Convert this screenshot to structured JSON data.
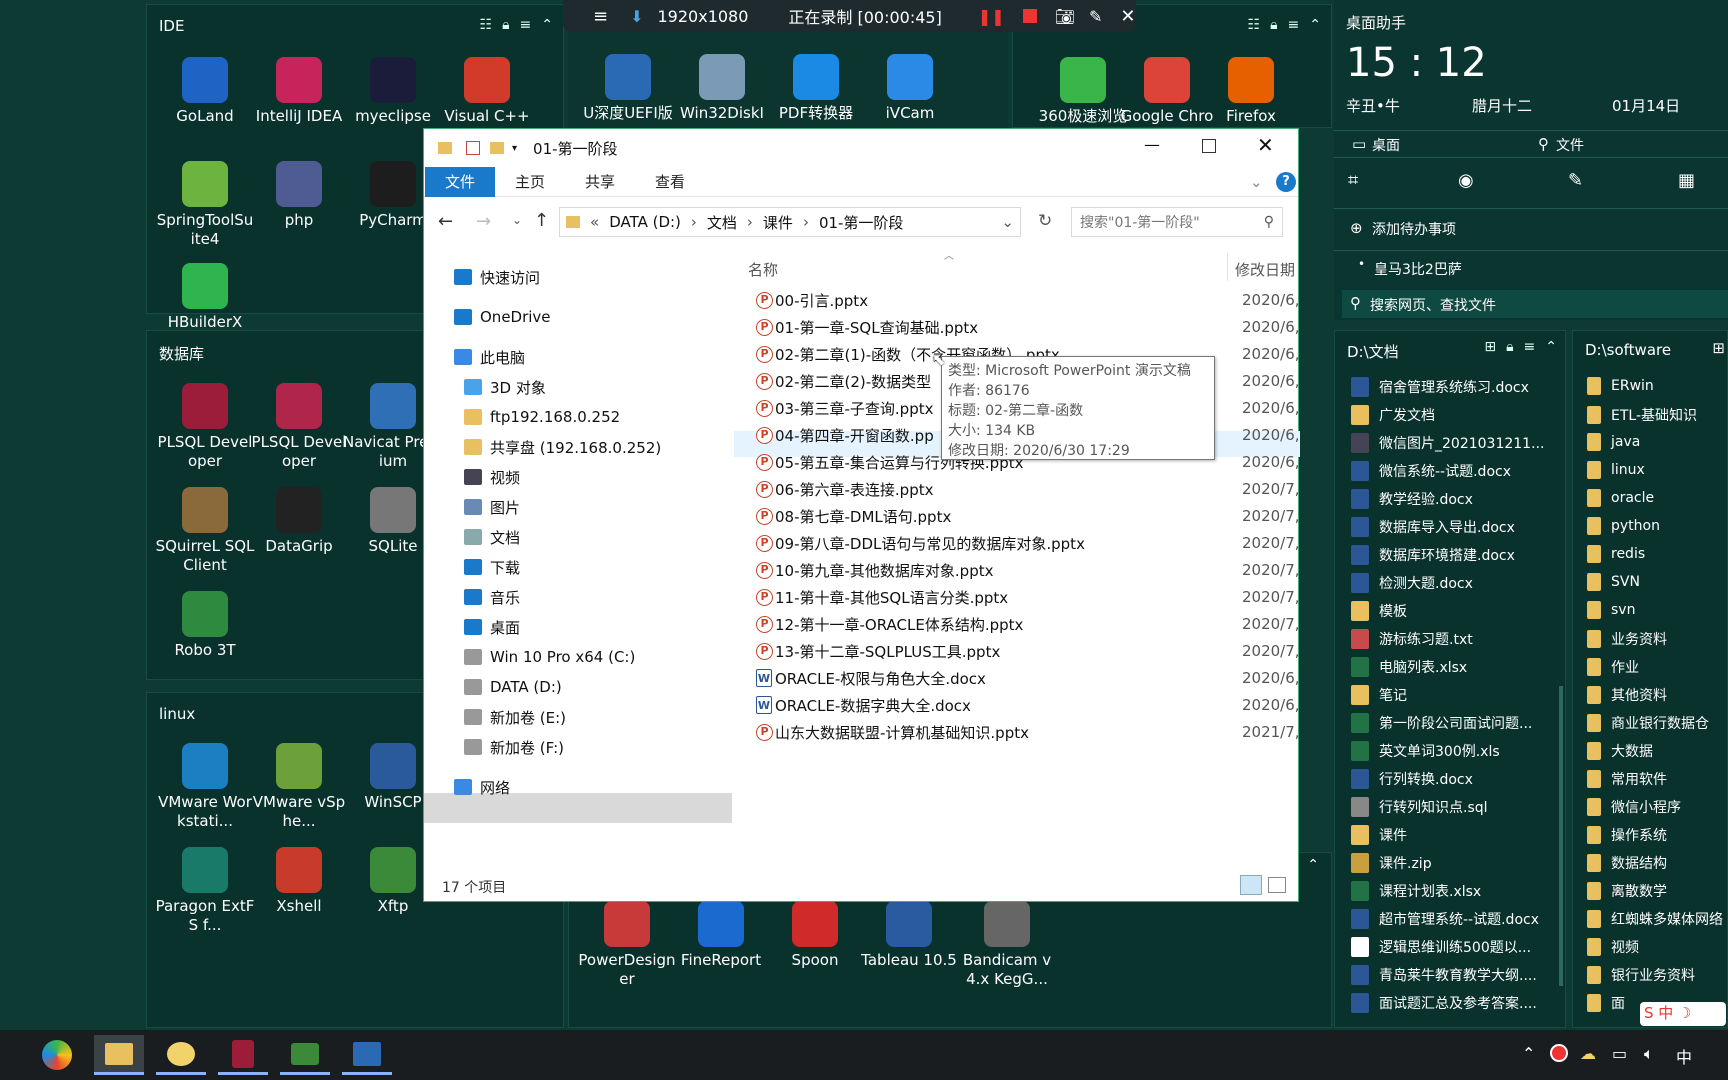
{
  "recorder": {
    "resolution": "1920x1080",
    "status": "正在录制 [00:00:45]"
  },
  "fences": {
    "ide": {
      "title": "IDE",
      "icons": [
        {
          "label": "GoLand",
          "icon": "goland-icon",
          "color": "#1f63c4"
        },
        {
          "label": "IntelliJ IDEA",
          "icon": "intellij-icon",
          "color": "#c8245c"
        },
        {
          "label": "myeclipse",
          "icon": "myeclipse-icon",
          "color": "#1b1b3a"
        },
        {
          "label": "Visual C++",
          "icon": "visual-cpp-icon",
          "color": "#d23a2a"
        },
        {
          "label": "SpringToolSuite4",
          "icon": "spring-icon",
          "color": "#6db33f"
        },
        {
          "label": "php",
          "icon": "php-icon",
          "color": "#4f5b93"
        },
        {
          "label": "PyCharm",
          "icon": "pycharm-icon",
          "color": "#1d1d1d"
        },
        {
          "label": "HBuilderX",
          "icon": "hbuilder-icon",
          "color": "#2fb550"
        }
      ]
    },
    "db": {
      "title": "数据库",
      "icons": [
        {
          "label": "PLSQL Developer",
          "icon": "plsql-icon",
          "color": "#9c1d3a"
        },
        {
          "label": "PLSQL Developer",
          "icon": "plsql-icon-2",
          "color": "#b0264a"
        },
        {
          "label": "Navicat Premium",
          "icon": "navicat-icon",
          "color": "#2e6fb6"
        },
        {
          "label": "SQuirreL SQL Client",
          "icon": "squirrel-icon",
          "color": "#8a6a3a"
        },
        {
          "label": "DataGrip",
          "icon": "datagrip-icon",
          "color": "#222"
        },
        {
          "label": "SQLite",
          "icon": "sqlite-icon",
          "color": "#777"
        },
        {
          "label": "Robo 3T",
          "icon": "robo3t-icon",
          "color": "#2d8a3e"
        }
      ]
    },
    "linux": {
      "title": "linux",
      "icons": [
        {
          "label": "VMware Workstati...",
          "icon": "vmware-icon",
          "color": "#1c7fc1"
        },
        {
          "label": "VMware vSphe...",
          "icon": "vsphere-icon",
          "color": "#6ca03a"
        },
        {
          "label": "WinSCP",
          "icon": "winscp-icon",
          "color": "#2a5a9a"
        },
        {
          "label": "Paragon ExtFS f...",
          "icon": "paragon-icon",
          "color": "#1a7a6a"
        },
        {
          "label": "Xshell",
          "icon": "xshell-icon",
          "color": "#c83a2a"
        },
        {
          "label": "Xftp",
          "icon": "xftp-icon",
          "color": "#3a8a3a"
        }
      ]
    },
    "tools": {
      "icons": [
        {
          "label": "U深度UEFI版",
          "icon": "usb-icon",
          "color": "#2a6ab5"
        },
        {
          "label": "Win32DiskI",
          "icon": "disk-icon",
          "color": "#7a9ab5"
        },
        {
          "label": "PDF转换器",
          "icon": "pdf-icon",
          "color": "#1a8ae5"
        },
        {
          "label": "iVCam",
          "icon": "ivcam-icon",
          "color": "#2a8ae5"
        }
      ]
    },
    "browsers": {
      "icons": [
        {
          "label": "360极速浏览器",
          "icon": "browser-360-icon",
          "color": "#3ab54a"
        },
        {
          "label": "Google Chrome",
          "icon": "chrome-icon",
          "color": "#db4437"
        },
        {
          "label": "Firefox",
          "icon": "firefox-icon",
          "color": "#e66000"
        }
      ]
    },
    "bottom": {
      "icons": [
        {
          "label": "PowerDesigner",
          "icon": "powerdesigner-icon",
          "color": "#c83a3a"
        },
        {
          "label": "FineReport",
          "icon": "finereport-icon",
          "color": "#1a6ad0"
        },
        {
          "label": "Spoon",
          "icon": "spoon-icon",
          "color": "#d02a2a"
        },
        {
          "label": "Tableau 10.5",
          "icon": "tableau-icon",
          "color": "#2a5aa0"
        },
        {
          "label": "Bandicam v4.x KegG...",
          "icon": "bandicam-icon",
          "color": "#666"
        }
      ]
    }
  },
  "explorer": {
    "title": "01-第一阶段",
    "tabs": [
      "文件",
      "主页",
      "共享",
      "查看"
    ],
    "breadcrumb": [
      "DATA (D:)",
      "文档",
      "课件",
      "01-第一阶段"
    ],
    "search_placeholder": "搜索\"01-第一阶段\"",
    "columns": {
      "name": "名称",
      "date": "修改日期"
    },
    "nav": [
      {
        "label": "快速访问",
        "icon": "star-icon"
      },
      {
        "label": "OneDrive",
        "icon": "cloud-icon"
      },
      {
        "label": "此电脑",
        "icon": "computer-icon"
      },
      {
        "label": "3D 对象",
        "icon": "cube-icon"
      },
      {
        "label": "ftp192.168.0.252",
        "icon": "ftp-folder-icon"
      },
      {
        "label": "共享盘 (192.168.0.252)",
        "icon": "share-folder-icon"
      },
      {
        "label": "视频",
        "icon": "video-icon"
      },
      {
        "label": "图片",
        "icon": "picture-icon"
      },
      {
        "label": "文档",
        "icon": "document-icon"
      },
      {
        "label": "下载",
        "icon": "download-icon"
      },
      {
        "label": "音乐",
        "icon": "music-icon"
      },
      {
        "label": "桌面",
        "icon": "desktop-icon"
      },
      {
        "label": "Win 10 Pro x64 (C:)",
        "icon": "drive-c-icon"
      },
      {
        "label": "DATA (D:)",
        "icon": "drive-d-icon"
      },
      {
        "label": "新加卷 (E:)",
        "icon": "drive-e-icon"
      },
      {
        "label": "新加卷 (F:)",
        "icon": "drive-f-icon"
      },
      {
        "label": "网络",
        "icon": "network-icon"
      }
    ],
    "files": [
      {
        "name": "00-引言.pptx",
        "date": "2020/6,",
        "type": "ppt"
      },
      {
        "name": "01-第一章-SQL查询基础.pptx",
        "date": "2020/6,",
        "type": "ppt"
      },
      {
        "name": "02-第二章(1)-函数（不含开窗函数）.pptx",
        "date": "2020/6,",
        "type": "ppt"
      },
      {
        "name": "02-第二章(2)-数据类型",
        "date": "2020/6,",
        "type": "ppt"
      },
      {
        "name": "03-第三章-子查询.pptx",
        "date": "2020/6,",
        "type": "ppt"
      },
      {
        "name": "04-第四章-开窗函数.pp",
        "date": "2020/6,",
        "type": "ppt"
      },
      {
        "name": "05-第五章-集合运算与行列转换.pptx",
        "date": "2020/6,",
        "type": "ppt"
      },
      {
        "name": "06-第六章-表连接.pptx",
        "date": "2020/7,",
        "type": "ppt"
      },
      {
        "name": "08-第七章-DML语句.pptx",
        "date": "2020/7,",
        "type": "ppt"
      },
      {
        "name": "09-第八章-DDL语句与常见的数据库对象.pptx",
        "date": "2020/7,",
        "type": "ppt"
      },
      {
        "name": "10-第九章-其他数据库对象.pptx",
        "date": "2020/7,",
        "type": "ppt"
      },
      {
        "name": "11-第十章-其他SQL语言分类.pptx",
        "date": "2020/7,",
        "type": "ppt"
      },
      {
        "name": "12-第十一章-ORACLE体系结构.pptx",
        "date": "2020/7,",
        "type": "ppt"
      },
      {
        "name": "13-第十二章-SQLPLUS工具.pptx",
        "date": "2020/7,",
        "type": "ppt"
      },
      {
        "name": "ORACLE-权限与角色大全.docx",
        "date": "2020/6,",
        "type": "doc"
      },
      {
        "name": "ORACLE-数据字典大全.docx",
        "date": "2020/6,",
        "type": "doc"
      },
      {
        "name": "山东大数据联盟-计算机基础知识.pptx",
        "date": "2021/7,",
        "type": "ppt"
      }
    ],
    "tooltip": {
      "type": "类型: Microsoft PowerPoint 演示文稿",
      "author": "作者: 86176",
      "title": "标题: 02-第二章-函数",
      "size": "大小: 134 KB",
      "modified": "修改日期: 2020/6/30 17:29"
    },
    "status": "17 个项目"
  },
  "assistant": {
    "title": "桌面助手",
    "time": "15 : 12",
    "ganzhi": "辛丑•牛",
    "lunar": "腊月十二",
    "date": "01月14日",
    "tab_desktop": "桌面",
    "tab_files": "文件",
    "add_todo": "添加待办事项",
    "todo_item": "皇马3比2巴萨",
    "search_placeholder": "搜索网页、查找文件"
  },
  "docs_fence": {
    "title": "D:\\文档",
    "items": [
      {
        "label": "宿舍管理系统练习.docx",
        "color": "#2b5797"
      },
      {
        "label": "广发文档",
        "color": "#e8c060"
      },
      {
        "label": "微信图片_2021031211...",
        "color": "#445"
      },
      {
        "label": "微信系统--试题.docx",
        "color": "#2b5797"
      },
      {
        "label": "教学经验.docx",
        "color": "#2b5797"
      },
      {
        "label": "数据库导入导出.docx",
        "color": "#2b5797"
      },
      {
        "label": "数据库环境搭建.docx",
        "color": "#2b5797"
      },
      {
        "label": "检测大题.docx",
        "color": "#2b5797"
      },
      {
        "label": "模板",
        "color": "#e8c060"
      },
      {
        "label": "游标练习题.txt",
        "color": "#c84a4a"
      },
      {
        "label": "电脑列表.xlsx",
        "color": "#217346"
      },
      {
        "label": "笔记",
        "color": "#e8c060"
      },
      {
        "label": "第一阶段公司面试问题...",
        "color": "#217346"
      },
      {
        "label": "英文单词300例.xls",
        "color": "#217346"
      },
      {
        "label": "行列转换.docx",
        "color": "#2b5797"
      },
      {
        "label": "行转列知识点.sql",
        "color": "#888"
      },
      {
        "label": "课件",
        "color": "#e8c060"
      },
      {
        "label": "课件.zip",
        "color": "#c8a040"
      },
      {
        "label": "课程计划表.xlsx",
        "color": "#217346"
      },
      {
        "label": "超市管理系统--试题.docx",
        "color": "#2b5797"
      },
      {
        "label": "逻辑思维训练500题以...",
        "color": "#fff"
      },
      {
        "label": "青岛莱牛教育教学大纲....",
        "color": "#2b5797"
      },
      {
        "label": "面试题汇总及参考答案....",
        "color": "#2b5797"
      }
    ]
  },
  "software_fence": {
    "title": "D:\\software",
    "items": [
      "ERwin",
      "ETL-基础知识",
      "java",
      "linux",
      "oracle",
      "python",
      "redis",
      "SVN",
      "svn",
      "业务资料",
      "作业",
      "其他资料",
      "商业银行数据仓",
      "大数据",
      "常用软件",
      "微信小程序",
      "操作系统",
      "数据结构",
      "离散数学",
      "红蜘蛛多媒体网络",
      "视频",
      "银行业务资料",
      "面"
    ]
  },
  "taskbar": {
    "ime": "中"
  }
}
